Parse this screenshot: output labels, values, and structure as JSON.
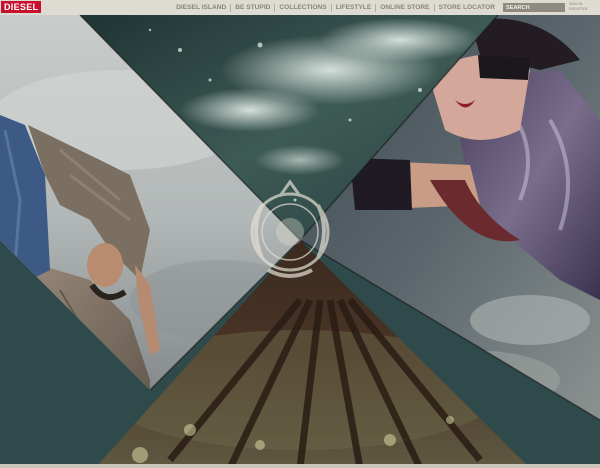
{
  "brand": {
    "logo_text": "DIESEL"
  },
  "nav": {
    "items": [
      {
        "label": "DIESEL ISLAND",
        "name": "nav-diesel-island"
      },
      {
        "label": "BE STUPID",
        "name": "nav-be-stupid"
      },
      {
        "label": "COLLECTIONS",
        "name": "nav-collections"
      },
      {
        "label": "LIFESTYLE",
        "name": "nav-lifestyle"
      },
      {
        "label": "ONLINE STORE",
        "name": "nav-online-store"
      },
      {
        "label": "STORE LOCATOR",
        "name": "nav-store-locator"
      }
    ]
  },
  "search": {
    "placeholder": "SEARCH"
  },
  "account": {
    "signin_label": "SIGN IN",
    "register_label": "REGISTER"
  },
  "colors": {
    "brand_red": "#c8102e",
    "nav_bar": "#dedbd2",
    "nav_text": "#8c8578",
    "corner_teal": "#2f4a4a"
  },
  "panels": [
    {
      "name": "panel-climber-photo",
      "icon": "climber-photo"
    },
    {
      "name": "panel-wave-photo",
      "icon": "wave-spray-photo"
    },
    {
      "name": "panel-woman-photo",
      "icon": "woman-portrait-photo"
    },
    {
      "name": "panel-sky-photo",
      "icon": "cloudy-sky-photo"
    },
    {
      "name": "panel-forest-photo",
      "icon": "forest-canopy-photo"
    }
  ],
  "emblem": {
    "icon": "diesel-island-crest-icon"
  }
}
